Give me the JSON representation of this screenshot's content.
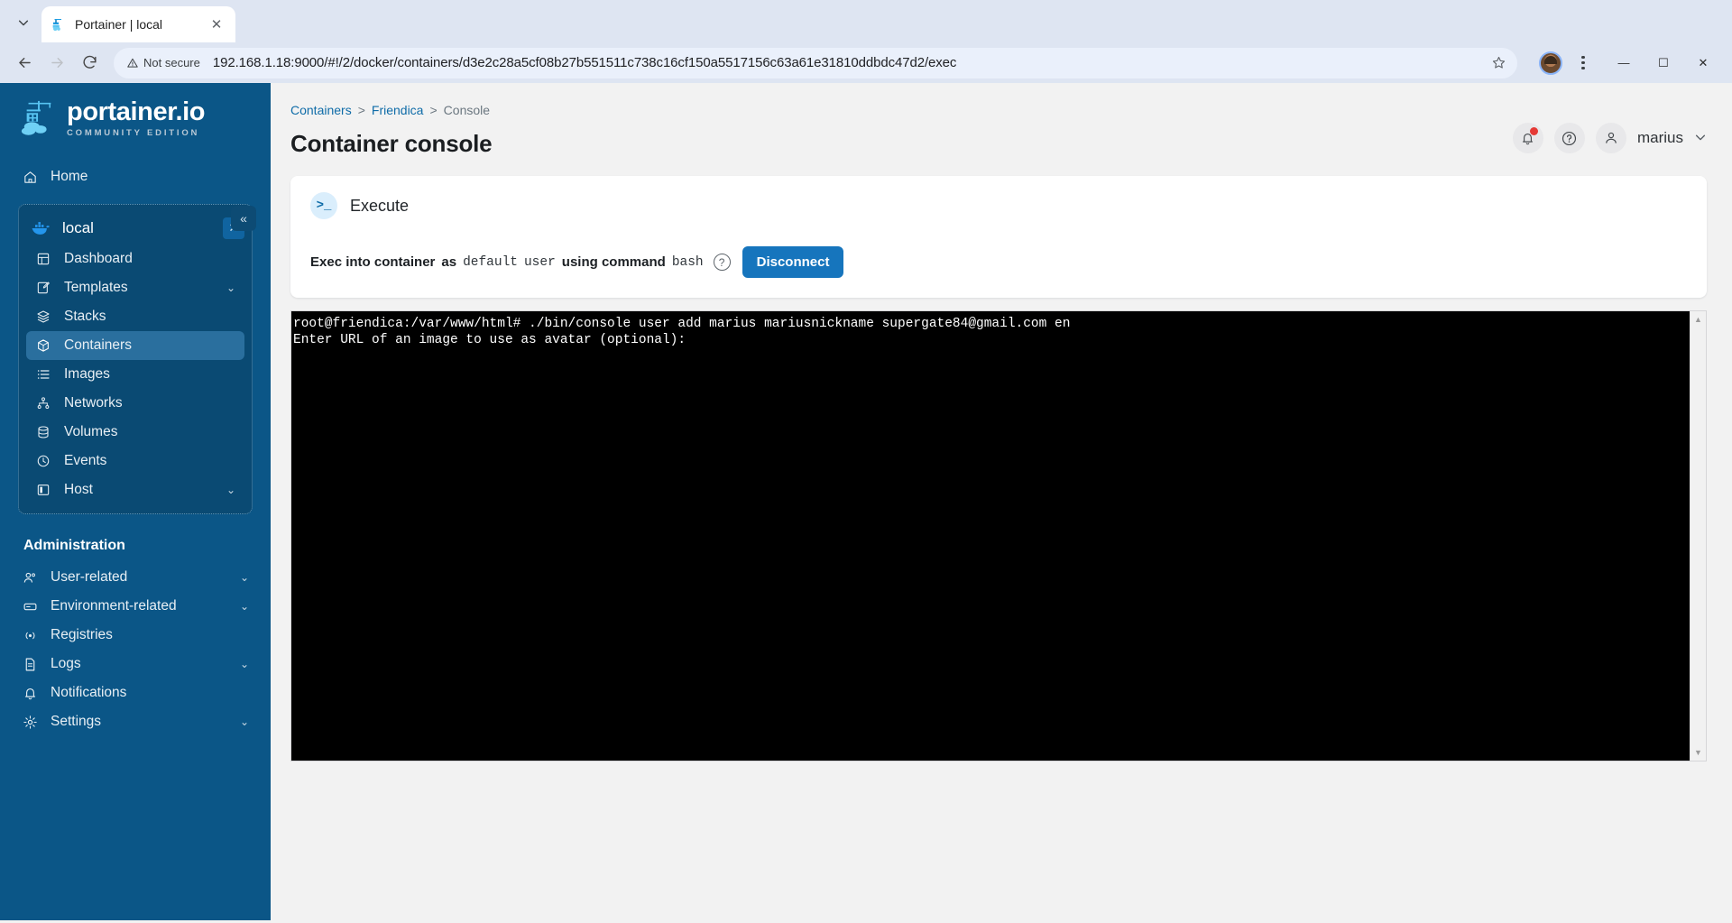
{
  "browser": {
    "tab": {
      "title": "Portainer | local",
      "favicon_icon": "portainer-favicon",
      "close_icon": "close-icon"
    },
    "tab_list_icon": "chevron-down-icon",
    "back_icon": "arrow-left-icon",
    "forward_icon": "arrow-right-icon",
    "reload_icon": "reload-icon",
    "security_label": "Not secure",
    "security_icon": "warning-triangle-icon",
    "url": "192.168.1.18:9000/#!/2/docker/containers/d3e2c28a5cf08b27b551511c738c16cf150a5517156c63a61e31810ddbdc47d2/exec",
    "bookmark_icon": "star-icon",
    "avatar_icon": "profile-avatar",
    "menu_icon": "kebab-menu-icon",
    "window": {
      "minimize": "—",
      "maximize": "☐",
      "close": "✕"
    }
  },
  "sidebar": {
    "logo": {
      "title": "portainer.io",
      "subtitle": "COMMUNITY EDITION",
      "icon": "portainer-crane-logo"
    },
    "collapse_label": "«",
    "home": {
      "label": "Home",
      "icon": "home-icon"
    },
    "environment": {
      "name": "local",
      "icon": "docker-whale-icon",
      "close_label": "✕",
      "items": [
        {
          "label": "Dashboard",
          "icon": "dashboard-icon",
          "caret": "",
          "active": false
        },
        {
          "label": "Templates",
          "icon": "templates-icon",
          "caret": "⌄",
          "active": false
        },
        {
          "label": "Stacks",
          "icon": "stacks-icon",
          "caret": "",
          "active": false
        },
        {
          "label": "Containers",
          "icon": "containers-icon",
          "caret": "",
          "active": true
        },
        {
          "label": "Images",
          "icon": "images-icon",
          "caret": "",
          "active": false
        },
        {
          "label": "Networks",
          "icon": "networks-icon",
          "caret": "",
          "active": false
        },
        {
          "label": "Volumes",
          "icon": "volumes-icon",
          "caret": "",
          "active": false
        },
        {
          "label": "Events",
          "icon": "events-clock-icon",
          "caret": "",
          "active": false
        },
        {
          "label": "Host",
          "icon": "host-icon",
          "caret": "⌄",
          "active": false
        }
      ]
    },
    "administration": {
      "title": "Administration",
      "items": [
        {
          "label": "User-related",
          "icon": "users-icon",
          "caret": "⌄"
        },
        {
          "label": "Environment-related",
          "icon": "environment-icon",
          "caret": "⌄"
        },
        {
          "label": "Registries",
          "icon": "registries-icon",
          "caret": ""
        },
        {
          "label": "Logs",
          "icon": "logs-icon",
          "caret": "⌄"
        },
        {
          "label": "Notifications",
          "icon": "bell-icon",
          "caret": ""
        },
        {
          "label": "Settings",
          "icon": "gear-icon",
          "caret": "⌄"
        }
      ]
    }
  },
  "header": {
    "breadcrumb": [
      {
        "label": "Containers",
        "link": true
      },
      {
        "label": "Friendica",
        "link": true
      },
      {
        "label": "Console",
        "link": false
      }
    ],
    "separator": ">",
    "title": "Container console",
    "notifications_icon": "bell-icon",
    "help_icon": "help-circle-icon",
    "user_icon": "person-icon",
    "user_name": "marius",
    "user_caret": "⌄"
  },
  "exec_card": {
    "icon": ">_",
    "icon_name": "terminal-prompt-icon",
    "title": "Execute",
    "line": {
      "part1": "Exec into container",
      "part2": "as",
      "user_mode": "default",
      "part3": "user",
      "part4": "using command",
      "command": "bash"
    },
    "help_icon": "help-circle-icon",
    "disconnect_label": "Disconnect"
  },
  "terminal": {
    "lines": [
      "root@friendica:/var/www/html# ./bin/console user add marius mariusnickname supergate84@gmail.com en",
      "Enter URL of an image to use as avatar (optional):"
    ],
    "scroll_up_icon": "▲",
    "scroll_down_icon": "▼"
  },
  "colors": {
    "sidebar_bg": "#0b5687",
    "env_block_bg": "#0a4a73",
    "active_item_bg": "#2a6f9e",
    "accent_blue": "#1675bd",
    "link_blue": "#0f6ca8",
    "page_bg": "#f2f2f2",
    "terminal_bg": "#000000",
    "terminal_fg": "#ffffff",
    "badge_red": "#e53935"
  }
}
